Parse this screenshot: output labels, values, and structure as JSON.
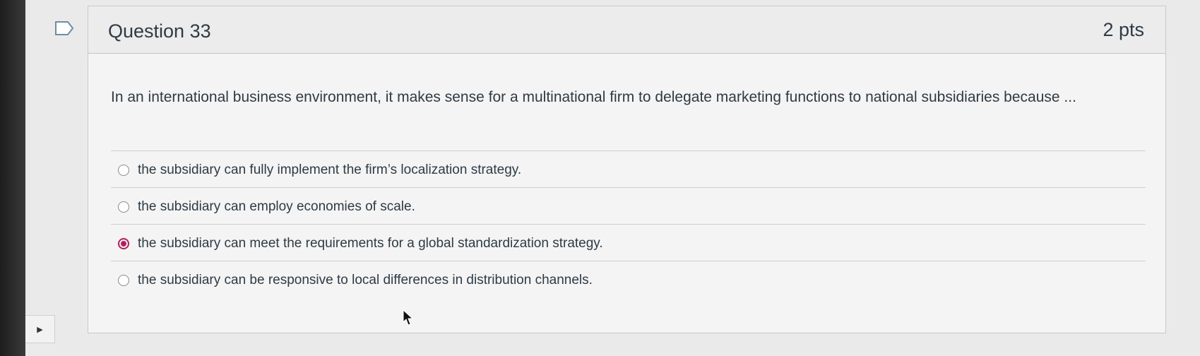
{
  "question": {
    "title": "Question 33",
    "points": "2 pts",
    "text": "In an international business environment, it makes sense for a multinational firm to delegate marketing functions to national subsidiaries because ...",
    "answers": [
      {
        "label": "the subsidiary can fully implement the firm’s localization strategy.",
        "selected": false
      },
      {
        "label": "the subsidiary can employ economies of scale.",
        "selected": false
      },
      {
        "label": "the subsidiary can meet the requirements for a global standardization strategy.",
        "selected": true
      },
      {
        "label": "the subsidiary can be responsive to local differences in distribution channels.",
        "selected": false
      }
    ]
  },
  "colors": {
    "selected_radio": "#c2185b",
    "text": "#2d3b45"
  },
  "icons": {
    "flag": "flag-outline-icon",
    "side_toggle": "triangle-right-icon",
    "cursor": "mouse-pointer-icon"
  }
}
